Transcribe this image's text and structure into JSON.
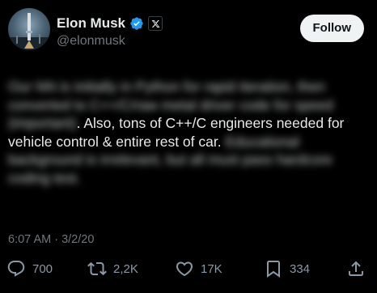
{
  "author": {
    "display_name": "Elon Musk",
    "handle": "@elonmusk",
    "verified_icon": "verified-badge-icon",
    "affiliate_icon": "x-logo-icon"
  },
  "follow_label": "Follow",
  "tweet": {
    "blurred_lead": "Our NN is initially in Python for rapid iteration, then converted to C++/C/raw metal driver code for speed (important)",
    "visible_text": ". Also, tons of C++/C engineers needed for vehicle control & entire rest of car.",
    "blurred_tail": "Educational background is irrelevant, but all must pass hardcore coding test."
  },
  "timestamp": "6:07 AM · 3/2/20",
  "actions": {
    "replies": "700",
    "reposts": "2,2K",
    "likes": "17K",
    "bookmarks": "334"
  },
  "colors": {
    "background": "#000000",
    "text": "#e7e9ea",
    "muted": "#71767b",
    "verified": "#1d9bf0",
    "follow_bg": "#eff3f4"
  }
}
